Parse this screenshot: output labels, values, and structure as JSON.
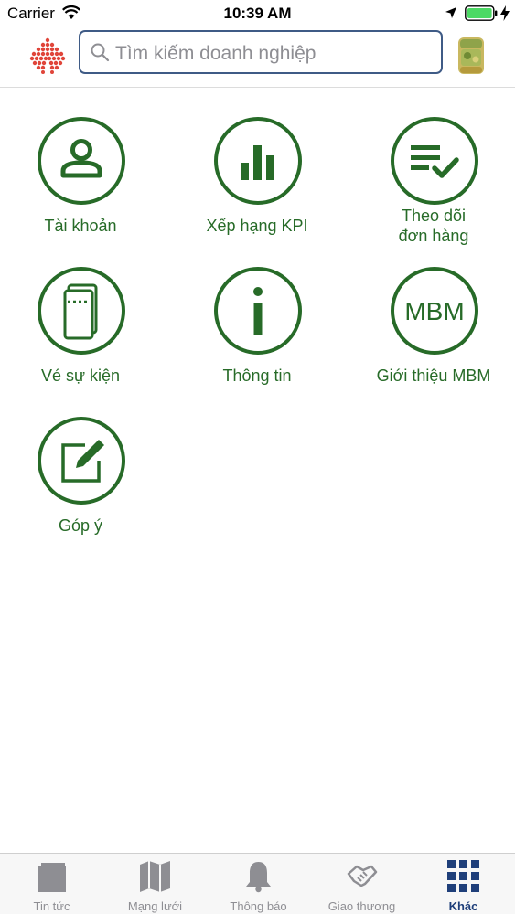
{
  "status_bar": {
    "carrier": "Carrier",
    "time": "10:39 AM"
  },
  "header": {
    "search_placeholder": "Tìm kiếm doanh nghiệp"
  },
  "menu": {
    "items": [
      {
        "label": "Tài khoản",
        "icon": "account-icon"
      },
      {
        "label": "Xếp hạng KPI",
        "icon": "kpi-chart-icon"
      },
      {
        "label": "Theo dõi\nđơn hàng",
        "icon": "order-tracking-icon"
      },
      {
        "label": "Vé sự kiện",
        "icon": "event-ticket-icon"
      },
      {
        "label": "Thông tin",
        "icon": "info-icon"
      },
      {
        "label": "Giới thiệu MBM",
        "icon": "mbm-icon"
      },
      {
        "label": "Góp ý",
        "icon": "feedback-edit-icon"
      }
    ],
    "mbm_text": "MBM",
    "accent_color": "#276b28"
  },
  "tab_bar": {
    "tabs": [
      {
        "label": "Tin tức",
        "icon": "news-icon"
      },
      {
        "label": "Mạng lưới",
        "icon": "map-icon"
      },
      {
        "label": "Thông báo",
        "icon": "bell-icon"
      },
      {
        "label": "Giao thương",
        "icon": "handshake-icon"
      },
      {
        "label": "Khác",
        "icon": "grid-icon",
        "active": true
      }
    ],
    "active_color": "#1f3f7a",
    "inactive_color": "#8e8e93"
  }
}
